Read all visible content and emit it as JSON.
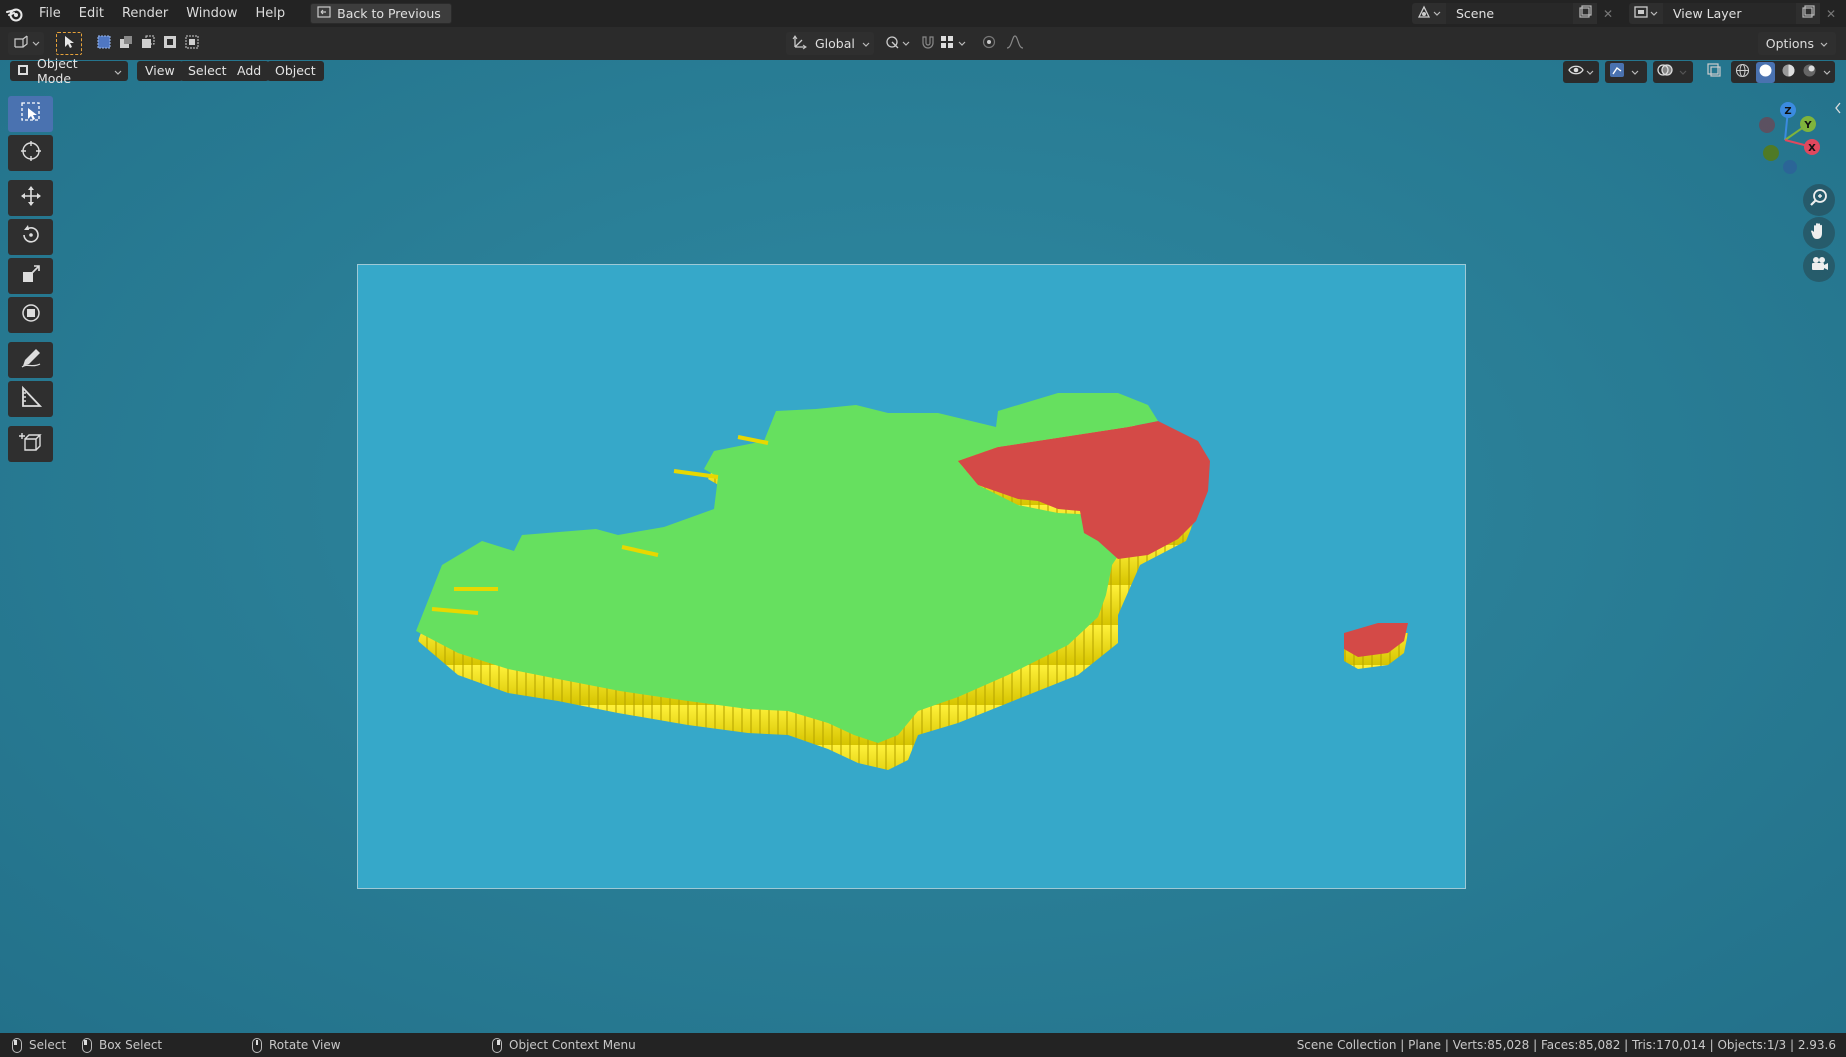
{
  "menubar": {
    "items": [
      "File",
      "Edit",
      "Render",
      "Window",
      "Help"
    ],
    "back_button": "Back to Previous",
    "scene": "Scene",
    "view_layer": "View Layer"
  },
  "toolheader": {
    "orientation": "Global",
    "options": "Options"
  },
  "viewport_header": {
    "mode": "Object Mode",
    "menus": [
      "View",
      "Select",
      "Add",
      "Object"
    ]
  },
  "toolbar": {
    "tools": [
      "select-box",
      "cursor",
      "move",
      "rotate",
      "scale",
      "transform",
      "annotate",
      "measure",
      "add-cube"
    ],
    "active": "select-box"
  },
  "gizmo": {
    "axes": [
      "X",
      "Y",
      "Z"
    ],
    "colors": {
      "x": "#e0485e",
      "y": "#7fb43c",
      "z": "#3b8be0"
    }
  },
  "scene_render": {
    "background": "#36a8c9",
    "land_color": "#66e05f",
    "highlight_color": "#d44a47",
    "extrusion_color": "#f0e020"
  },
  "statusbar": {
    "select": "Select",
    "box_select": "Box Select",
    "rotate_view": "Rotate View",
    "context_menu": "Object Context Menu",
    "stats": "Scene Collection | Plane | Verts:85,028 | Faces:85,082 | Tris:170,014 | Objects:1/3 | 2.93.6"
  }
}
